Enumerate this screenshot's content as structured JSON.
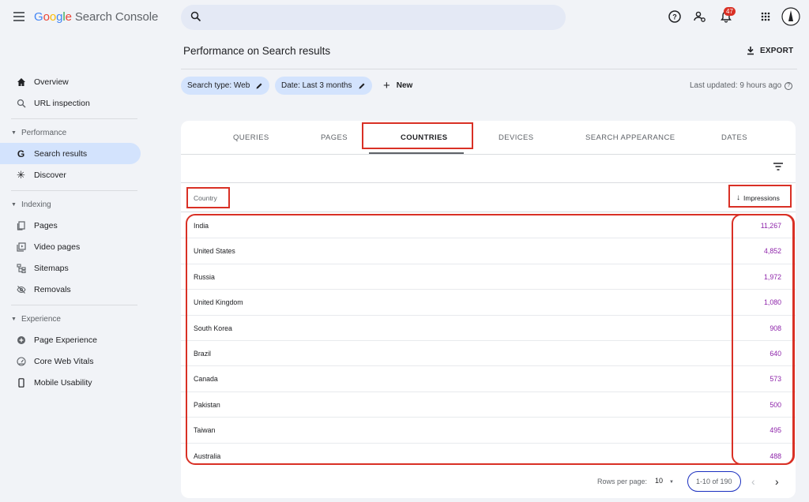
{
  "app": {
    "logo_google": "Google",
    "logo_rest": " Search Console",
    "notification_count": "47"
  },
  "search": {
    "placeholder": ""
  },
  "sidebar": {
    "items": [
      {
        "label": "Overview",
        "icon": "home-icon"
      },
      {
        "label": "URL inspection",
        "icon": "search-icon"
      }
    ],
    "performance": {
      "label": "Performance",
      "items": [
        {
          "label": "Search results",
          "icon": "google-g-icon",
          "active": true
        },
        {
          "label": "Discover",
          "icon": "asterisk-icon"
        }
      ]
    },
    "indexing": {
      "label": "Indexing",
      "items": [
        {
          "label": "Pages",
          "icon": "pages-icon"
        },
        {
          "label": "Video pages",
          "icon": "video-pages-icon"
        },
        {
          "label": "Sitemaps",
          "icon": "sitemap-icon"
        },
        {
          "label": "Removals",
          "icon": "eye-off-icon"
        }
      ]
    },
    "experience": {
      "label": "Experience",
      "items": [
        {
          "label": "Page Experience",
          "icon": "plus-circle-icon"
        },
        {
          "label": "Core Web Vitals",
          "icon": "gauge-icon"
        },
        {
          "label": "Mobile Usability",
          "icon": "phone-icon"
        }
      ]
    }
  },
  "header": {
    "title": "Performance on Search results",
    "export_label": "EXPORT"
  },
  "filters": {
    "search_type": "Search type: Web",
    "date": "Date: Last 3 months",
    "new_label": "New",
    "last_updated": "Last updated: 9 hours ago"
  },
  "tabs": [
    "QUERIES",
    "PAGES",
    "COUNTRIES",
    "DEVICES",
    "SEARCH APPEARANCE",
    "DATES"
  ],
  "table": {
    "col_country": "Country",
    "col_impressions": "Impressions",
    "rows": [
      {
        "country": "India",
        "impressions": "11,267"
      },
      {
        "country": "United States",
        "impressions": "4,852"
      },
      {
        "country": "Russia",
        "impressions": "1,972"
      },
      {
        "country": "United Kingdom",
        "impressions": "1,080"
      },
      {
        "country": "South Korea",
        "impressions": "908"
      },
      {
        "country": "Brazil",
        "impressions": "640"
      },
      {
        "country": "Canada",
        "impressions": "573"
      },
      {
        "country": "Pakistan",
        "impressions": "500"
      },
      {
        "country": "Taiwan",
        "impressions": "495"
      },
      {
        "country": "Australia",
        "impressions": "488"
      }
    ]
  },
  "pagination": {
    "rows_per_page_label": "Rows per page:",
    "rows_per_page_value": "10",
    "range": "1-10 of 190"
  },
  "colors": {
    "accent_chip": "#d3e3fd",
    "impression_value": "#8e24aa",
    "highlight_red": "#d93025",
    "highlight_blue": "#1a2fbf"
  }
}
